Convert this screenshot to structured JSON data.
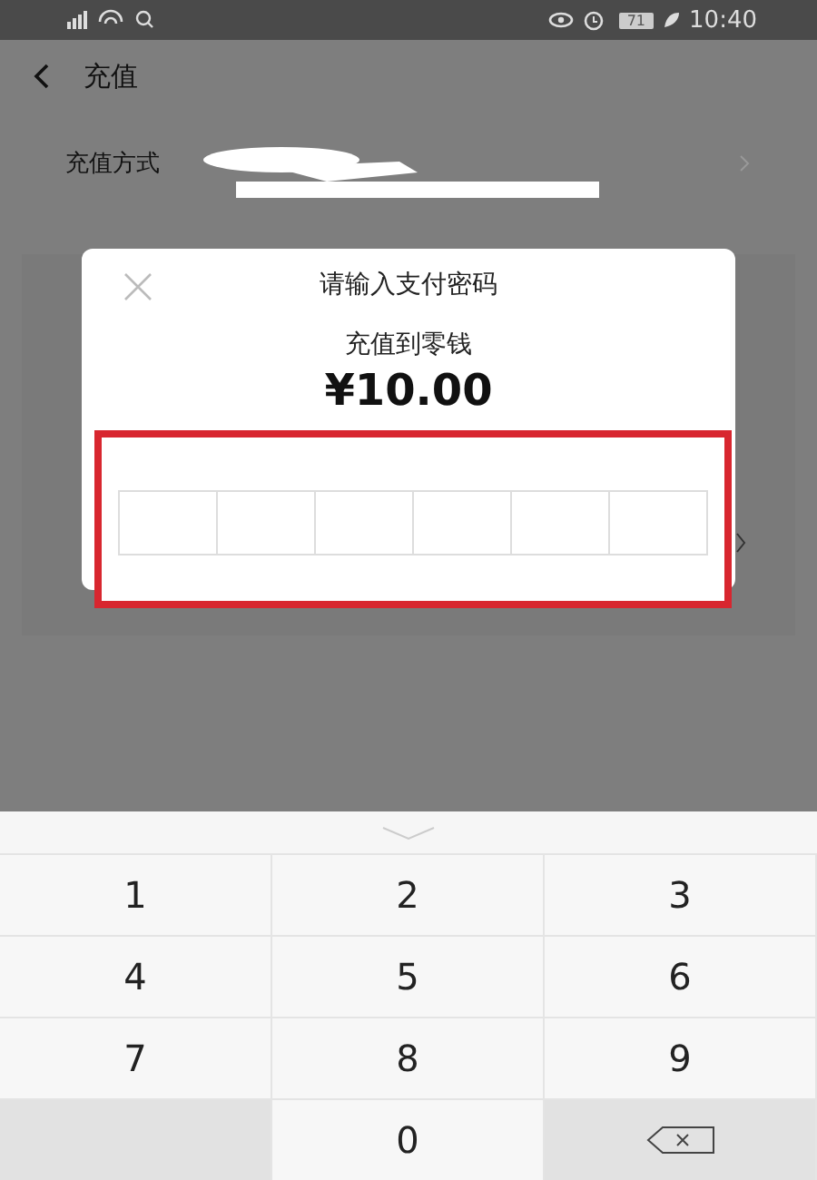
{
  "status_bar": {
    "battery": "71",
    "time": "10:40"
  },
  "header": {
    "title": "充值"
  },
  "method_row": {
    "label": "充值方式"
  },
  "dialog": {
    "title": "请输入支付密码",
    "subtitle": "充值到零钱",
    "amount": "¥10.00",
    "password_cells": [
      {
        "filled": false
      },
      {
        "filled": false
      },
      {
        "filled": false
      },
      {
        "filled": false
      },
      {
        "filled": false
      },
      {
        "filled": false
      }
    ]
  },
  "keypad": {
    "keys": [
      {
        "kind": "digit",
        "label": "1"
      },
      {
        "kind": "digit",
        "label": "2"
      },
      {
        "kind": "digit",
        "label": "3"
      },
      {
        "kind": "digit",
        "label": "4"
      },
      {
        "kind": "digit",
        "label": "5"
      },
      {
        "kind": "digit",
        "label": "6"
      },
      {
        "kind": "digit",
        "label": "7"
      },
      {
        "kind": "digit",
        "label": "8"
      },
      {
        "kind": "digit",
        "label": "9"
      },
      {
        "kind": "blank"
      },
      {
        "kind": "digit",
        "label": "0"
      },
      {
        "kind": "delete"
      }
    ]
  }
}
